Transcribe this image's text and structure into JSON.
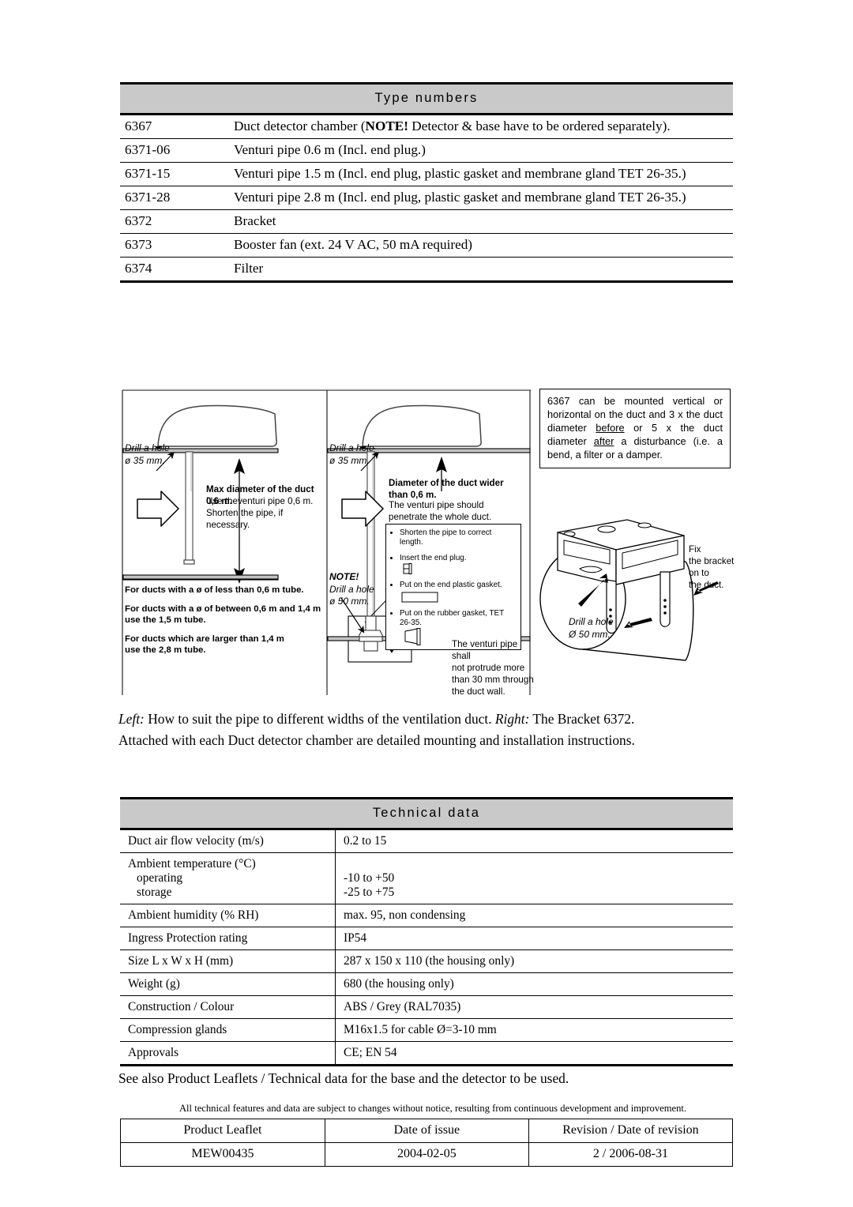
{
  "type_numbers": {
    "heading": "Type numbers",
    "rows": [
      {
        "code": "6367",
        "desc_pre": "Duct detector chamber   (",
        "desc_bold": "NOTE!",
        "desc_post": "  Detector & base have to be ordered separately)."
      },
      {
        "code": "6371-06",
        "desc": "Venturi pipe 0.6 m  (Incl. end plug.)"
      },
      {
        "code": "6371-15",
        "desc": "Venturi pipe 1.5 m  (Incl. end plug, plastic gasket and membrane gland TET 26-35.)"
      },
      {
        "code": "6371-28",
        "desc": "Venturi pipe 2.8 m  (Incl. end plug, plastic gasket and membrane gland TET 26-35.)"
      },
      {
        "code": "6372",
        "desc": "Bracket"
      },
      {
        "code": "6373",
        "desc": "Booster fan   (ext. 24 V AC, 50 mA required)"
      },
      {
        "code": "6374",
        "desc": "Filter"
      }
    ]
  },
  "figure": {
    "mounting_note": {
      "line_pre": "6367 can be mounted vertical or horizontal on the duct and 3 x the duct diameter ",
      "u1": "before",
      "mid": " or 5 x the duct diameter ",
      "u2": "after",
      "line_post": " a disturbance (i.e. a bend, a filter or a damper."
    },
    "left_panel": {
      "drill_line1": "Drill a hole",
      "drill_line2": "ø 35 mm.",
      "title": "Max diameter of the duct 0,6 m.",
      "sub1": "Use theventuri pipe 0,6 m.",
      "sub2": "Shorten the pipe, if necessary.",
      "rule1": "For ducts with a ø of less than 0,6 m tube.",
      "rule2a": "For ducts with a ø of between 0,6 m and 1,4 m",
      "rule2b": "use the 1,5 m tube.",
      "rule3a": "For ducts which are larger than 1,4 m",
      "rule3b": "use the 2,8 m tube."
    },
    "mid_panel": {
      "drill_line1": "Drill a hole",
      "drill_line2": "ø 35 mm.",
      "title1": "Diameter of the duct wider",
      "title2": "than 0,6 m.",
      "sub1": "The venturi pipe should",
      "sub2": "penetrate the whole duct.",
      "bullets": [
        "Shorten the pipe to correct length.",
        "Insert the end plug.",
        "Put on the end plastic gasket.",
        "Put on the rubber gasket, TET 26-35."
      ],
      "note_label": "NOTE!",
      "note_line1": "Drill a hole",
      "note_line2": "ø 50 mm.",
      "protrude1": "The venturi pipe shall",
      "protrude2": "not protrude more",
      "protrude3": "than 30 mm through",
      "protrude4": "the duct wall."
    },
    "right_panel": {
      "fix1": "Fix",
      "fix2": "the bracket",
      "fix3": "on to",
      "fix4": "the duct.",
      "drill1": "Drill a hole",
      "drill2": "Ø 50 mm."
    }
  },
  "caption": {
    "left_label": "Left:",
    "left_text": "  How to suit the pipe to different widths of the ventilation duct.  ",
    "right_label": "Right:",
    "right_text": "  The Bracket 6372.",
    "line2": "Attached with each Duct detector chamber are detailed mounting and installation instructions."
  },
  "technical_data": {
    "heading": "Technical data",
    "rows": [
      {
        "key": "Duct air flow velocity (m/s)",
        "value": "0.2 to 15"
      },
      {
        "key": "Ambient temperature (°C)",
        "key_sub1": "operating",
        "key_sub2": "storage",
        "value": "",
        "value_sub1": "-10 to +50",
        "value_sub2": "-25 to +75"
      },
      {
        "key": "Ambient humidity (% RH)",
        "value": "max. 95, non condensing"
      },
      {
        "key": "Ingress Protection rating",
        "value": "IP54"
      },
      {
        "key": "Size L x W x H (mm)",
        "value": "287 x 150 x 110 (the housing only)"
      },
      {
        "key": "Weight (g)",
        "value": "680 (the housing only)"
      },
      {
        "key": "Construction / Colour",
        "value": "ABS / Grey  (RAL7035)"
      },
      {
        "key": "Compression glands",
        "value": "M16x1.5 for cable Ø=3-10 mm"
      },
      {
        "key": "Approvals",
        "value": "CE;  EN 54"
      }
    ]
  },
  "see_also": "See also Product Leaflets / Technical data for the base and the detector to be used.",
  "disclaimer": "All technical features and data are subject to changes without notice, resulting from continuous development and improvement.",
  "footer_table": {
    "headers": [
      "Product Leaflet",
      "Date of issue",
      "Revision / Date of revision"
    ],
    "values": [
      "MEW00435",
      "2004-02-05",
      "2 / 2006-08-31"
    ]
  },
  "colors": {
    "header_band": "#c9c9c9",
    "rule": "#000000"
  }
}
